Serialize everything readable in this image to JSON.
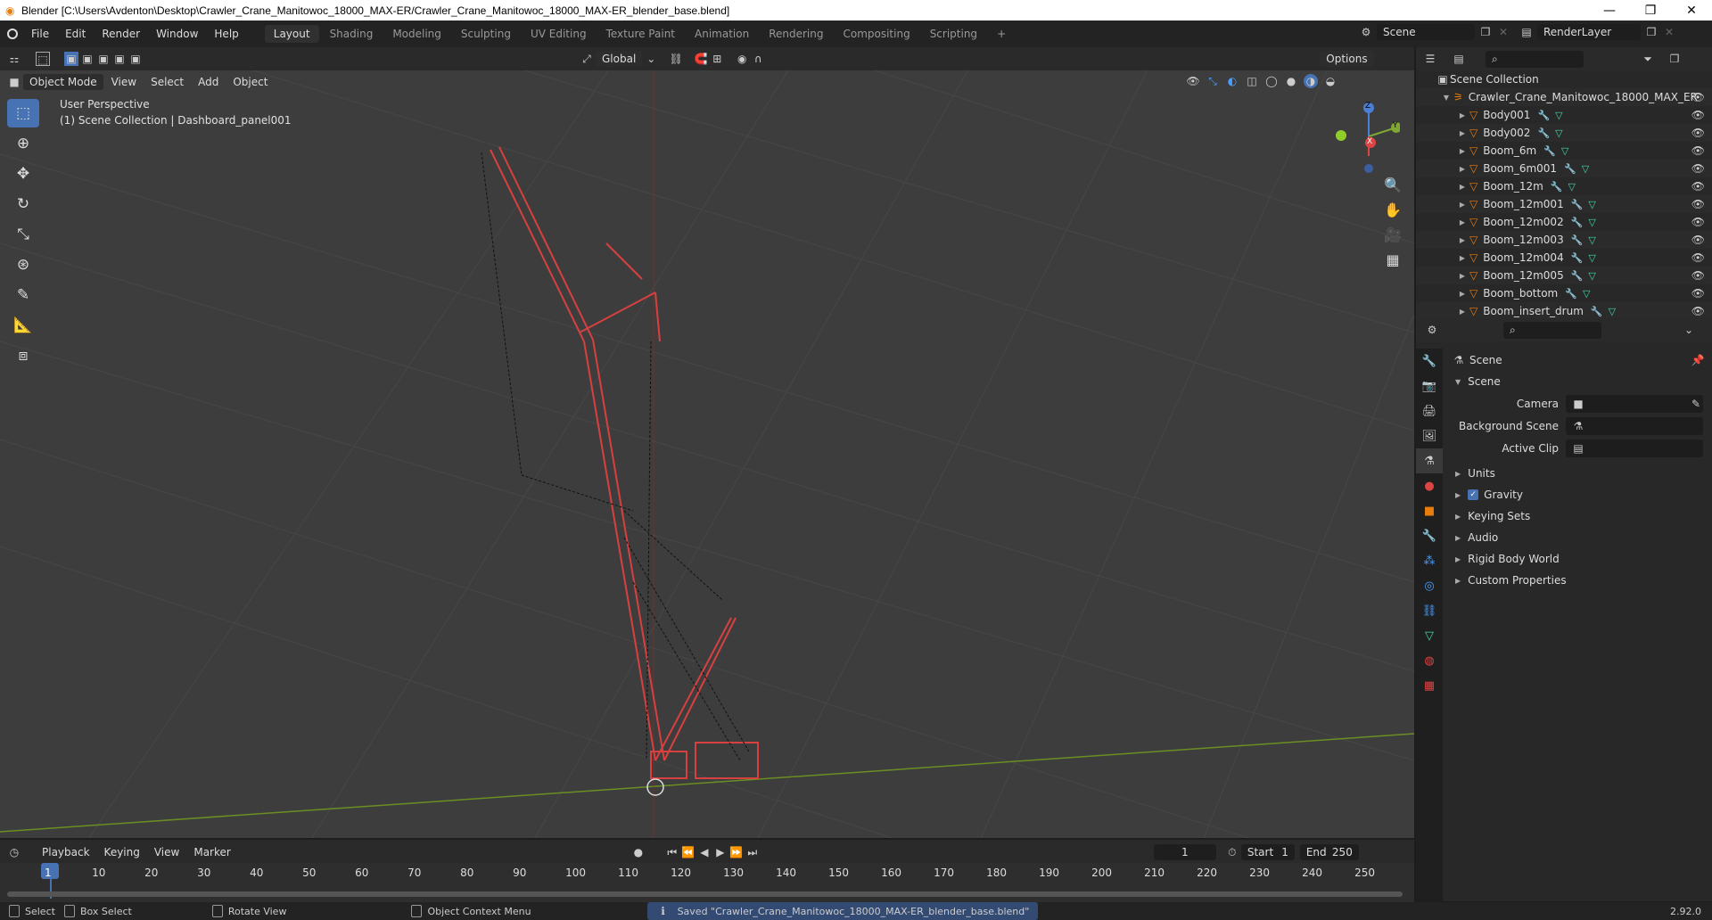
{
  "window": {
    "title": "Blender [C:\\Users\\Avdenton\\Desktop\\Crawler_Crane_Manitowoc_18000_MAX-ER/Crawler_Crane_Manitowoc_18000_MAX-ER_blender_base.blend]",
    "min": "—",
    "max": "❐",
    "close": "✕"
  },
  "menu": {
    "items": [
      "File",
      "Edit",
      "Render",
      "Window",
      "Help"
    ]
  },
  "workspaces": [
    "Layout",
    "Shading",
    "Modeling",
    "Sculpting",
    "UV Editing",
    "Texture Paint",
    "Animation",
    "Rendering",
    "Compositing",
    "Scripting"
  ],
  "workspace_add": "+",
  "scene_selector": {
    "value": "Scene"
  },
  "view_layer": {
    "value": "RenderLayer"
  },
  "viewport": {
    "mode": "Object Mode",
    "menus": [
      "View",
      "Select",
      "Add",
      "Object"
    ],
    "transform_orientation": "Global",
    "options": "Options",
    "overlay_line1": "User Perspective",
    "overlay_line2": "(1) Scene Collection | Dashboard_panel001",
    "gizmo_labels": {
      "z": "Z",
      "y": "Y",
      "x": "X"
    }
  },
  "outliner": {
    "root": "Scene Collection",
    "collection": "Crawler_Crane_Manitowoc_18000_MAX_ER",
    "objects": [
      "Body001",
      "Body002",
      "Boom_6m",
      "Boom_6m001",
      "Boom_12m",
      "Boom_12m001",
      "Boom_12m002",
      "Boom_12m003",
      "Boom_12m004",
      "Boom_12m005",
      "Boom_bottom",
      "Boom_insert_drum"
    ]
  },
  "properties": {
    "header": "Scene",
    "section": "Scene",
    "fields": [
      {
        "label": "Camera",
        "value": ""
      },
      {
        "label": "Background Scene",
        "value": ""
      },
      {
        "label": "Active Clip",
        "value": ""
      }
    ],
    "subsections": [
      "Units",
      "Gravity",
      "Keying Sets",
      "Audio",
      "Rigid Body World",
      "Custom Properties"
    ],
    "gravity_checked": true
  },
  "timeline": {
    "menus": [
      "Playback",
      "Keying",
      "View",
      "Marker"
    ],
    "current_frame": "1",
    "start_label": "Start",
    "start": "1",
    "end_label": "End",
    "end": "250",
    "frames": [
      "1",
      "10",
      "20",
      "30",
      "40",
      "50",
      "60",
      "70",
      "80",
      "90",
      "100",
      "110",
      "120",
      "130",
      "140",
      "150",
      "160",
      "170",
      "180",
      "190",
      "200",
      "210",
      "220",
      "230",
      "240",
      "250"
    ]
  },
  "statusbar": {
    "select": "Select",
    "box_select": "Box Select",
    "rotate": "Rotate View",
    "context": "Object Context Menu",
    "message": "Saved \"Crawler_Crane_Manitowoc_18000_MAX-ER_blender_base.blend\"",
    "version": "2.92.0"
  }
}
